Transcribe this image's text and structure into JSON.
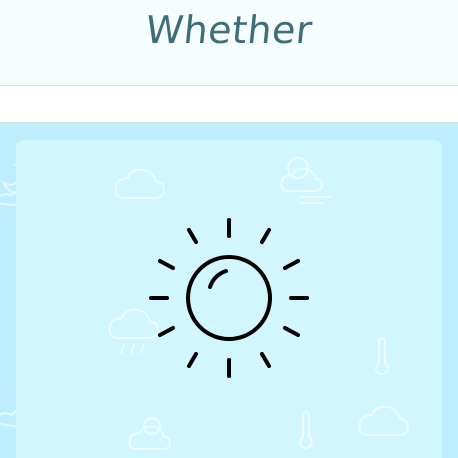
{
  "header": {
    "title": "Whether"
  },
  "search": {
    "value": "",
    "placeholder": ""
  },
  "weather": {
    "condition_icon": "sun-icon"
  },
  "colors": {
    "title": "#3f6d78",
    "header_bg": "#f5fdff",
    "sky_bg": "#bdeeff",
    "card_bg": "#d2f5ff",
    "icon_stroke": "#000000"
  }
}
